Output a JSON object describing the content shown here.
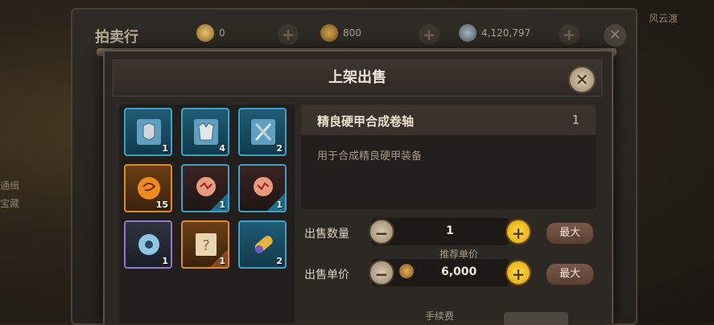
{
  "background": {
    "title": "拍卖行",
    "currencies": [
      {
        "icon": "gold-ingot-icon",
        "value": "0",
        "color": "#c99a3d"
      },
      {
        "icon": "gold-coin-icon",
        "value": "800",
        "color": "#b5862e"
      },
      {
        "icon": "silver-coin-icon",
        "value": "4,120,797",
        "color": "#7d8c96"
      }
    ],
    "side_texts": [
      "风云渡",
      "通缉",
      "宝藏"
    ]
  },
  "dialog": {
    "title": "上架出售",
    "inventory": [
      {
        "icon": "armor-scroll-icon",
        "count": "1",
        "rarity": "blue"
      },
      {
        "icon": "robe-scroll-icon",
        "count": "4",
        "rarity": "blue"
      },
      {
        "icon": "swords-scroll-icon",
        "count": "2",
        "rarity": "blue"
      },
      {
        "icon": "orange-orb-icon",
        "count": "15",
        "rarity": "orange"
      },
      {
        "icon": "red-orb-icon",
        "count": "1",
        "rarity": "blue"
      },
      {
        "icon": "red-orb-icon",
        "count": "1",
        "rarity": "blue"
      },
      {
        "icon": "blue-ring-icon",
        "count": "1",
        "rarity": "purple"
      },
      {
        "icon": "mystery-scroll-icon",
        "count": "1",
        "rarity": "orange"
      },
      {
        "icon": "gold-cannon-icon",
        "count": "2",
        "rarity": "blue"
      }
    ],
    "selected_item": {
      "name": "精良硬甲合成卷轴",
      "quantity": "1",
      "description": "用于合成精良硬甲装备"
    },
    "sell_quantity": {
      "label": "出售数量",
      "value": "1",
      "max_label": "最大"
    },
    "recommended_price_label": "推荐单价",
    "sell_price": {
      "label": "出售单价",
      "value": "6,000",
      "max_label": "最大"
    },
    "fee_label": "手续费"
  }
}
